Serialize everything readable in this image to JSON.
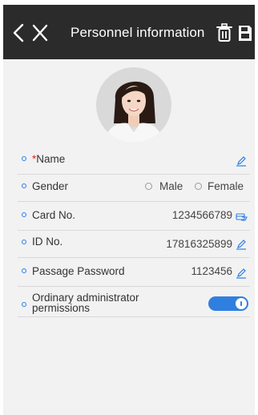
{
  "header": {
    "title": "Personnel information",
    "back_icon": "chevron-left-icon",
    "close_icon": "close-icon",
    "delete_icon": "trash-icon",
    "save_icon": "save-icon",
    "background": "#2b2b2b"
  },
  "profile": {
    "avatar_icon": "user-photo"
  },
  "fields": {
    "name": {
      "required_mark": "*",
      "label": "Name",
      "value": "",
      "edit_icon": "pencil-icon"
    },
    "gender": {
      "label": "Gender",
      "options": [
        "Male",
        "Female"
      ],
      "selected": ""
    },
    "card_no": {
      "label": "Card No.",
      "value": "1234566789",
      "action_icon": "card-reader-icon"
    },
    "id_no": {
      "label": "ID No.",
      "value": "17816325899",
      "edit_icon": "pencil-icon"
    },
    "passage_password": {
      "label": "Passage Password",
      "value": "1123456",
      "edit_icon": "pencil-icon"
    },
    "admin_permission": {
      "label_line1": "Ordinary administrator",
      "label_line2": "permissions",
      "enabled": true
    }
  },
  "colors": {
    "accent": "#2f7fe0",
    "required": "#e2231a",
    "content_bg": "#f2f2f2"
  }
}
